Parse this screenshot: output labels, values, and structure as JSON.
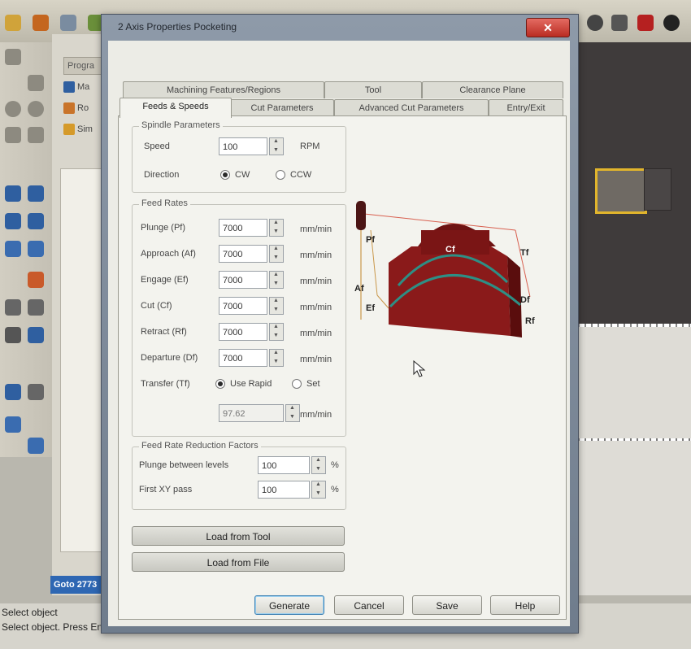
{
  "app": {
    "back_panel_tab": "Progra",
    "back_items": [
      "Ma",
      "Ro",
      "Sim"
    ],
    "goto_label": "Goto 2773",
    "status_line1": "Select object",
    "status_line2": "Select object. Press Enter when done"
  },
  "dialog": {
    "title": "2 Axis Properties Pocketing",
    "close_glyph": "✕",
    "tabs_row1": [
      "Machining Features/Regions",
      "Tool",
      "Clearance Plane"
    ],
    "tabs_row2": [
      "Feeds & Speeds",
      "Cut Parameters",
      "Advanced Cut Parameters",
      "Entry/Exit"
    ],
    "active_tab": "Feeds & Speeds",
    "spindle": {
      "title": "Spindle Parameters",
      "speed_label": "Speed",
      "speed_value": "100",
      "speed_unit": "RPM",
      "direction_label": "Direction",
      "cw_label": "CW",
      "ccw_label": "CCW",
      "direction_selected": "CW"
    },
    "feed_rates": {
      "title": "Feed Rates",
      "rows": [
        {
          "label": "Plunge (Pf)",
          "value": "7000",
          "unit": "mm/min"
        },
        {
          "label": "Approach (Af)",
          "value": "7000",
          "unit": "mm/min"
        },
        {
          "label": "Engage (Ef)",
          "value": "7000",
          "unit": "mm/min"
        },
        {
          "label": "Cut (Cf)",
          "value": "7000",
          "unit": "mm/min"
        },
        {
          "label": "Retract (Rf)",
          "value": "7000",
          "unit": "mm/min"
        },
        {
          "label": "Departure (Df)",
          "value": "7000",
          "unit": "mm/min"
        }
      ],
      "transfer_label": "Transfer (Tf)",
      "use_rapid_label": "Use Rapid",
      "set_label": "Set",
      "transfer_selected": "Use Rapid",
      "transfer_value": "97.62",
      "transfer_unit": "mm/min"
    },
    "reduction": {
      "title": "Feed Rate Reduction Factors",
      "rows": [
        {
          "label": "Plunge between levels",
          "value": "100",
          "unit": "%"
        },
        {
          "label": "First XY pass",
          "value": "100",
          "unit": "%"
        }
      ]
    },
    "diagram_labels": {
      "pf": "Pf",
      "cf": "Cf",
      "tf": "Tf",
      "af": "Af",
      "ef": "Ef",
      "df": "Df",
      "rf": "Rf"
    },
    "load_from_tool": "Load from Tool",
    "load_from_file": "Load from File",
    "buttons": {
      "generate": "Generate",
      "cancel": "Cancel",
      "save": "Save",
      "help": "Help"
    }
  },
  "colors": {
    "part": "#8a1a1a",
    "toolpath": "#2e8f85",
    "accent_blue": "#2e67b3",
    "close_red": "#c0342a"
  }
}
